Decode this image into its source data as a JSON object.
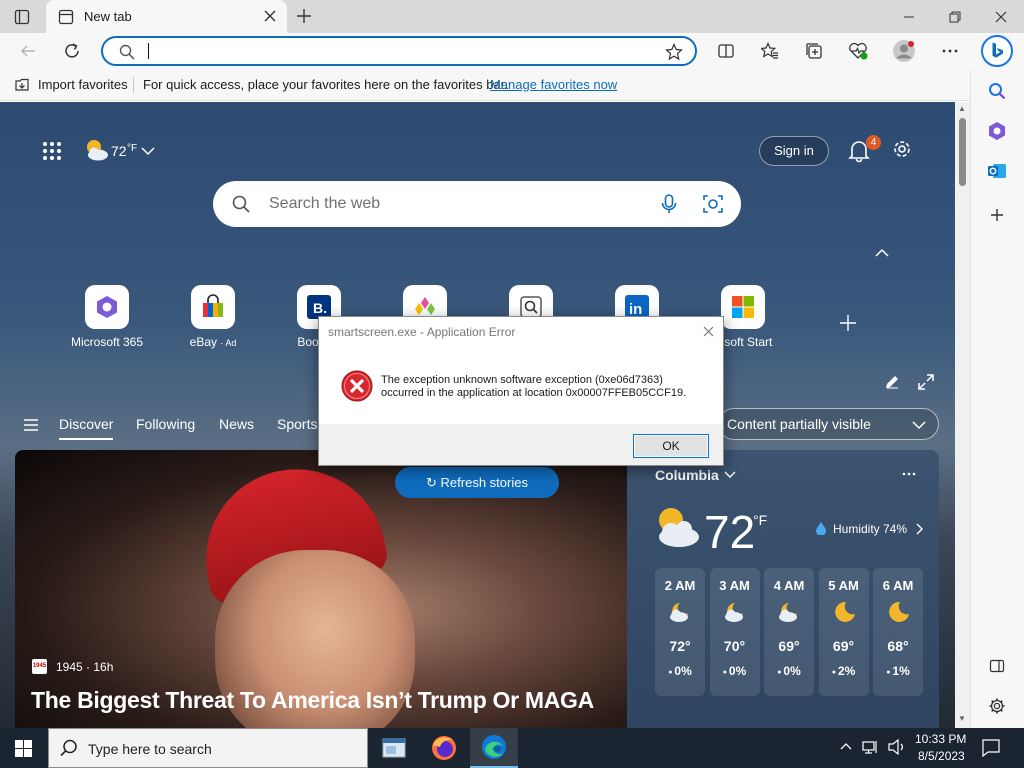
{
  "browser": {
    "tab_title": "New tab",
    "address_value": "",
    "favorites_bar": {
      "import_label": "Import favorites",
      "message": "For quick access, place your favorites here on the favorites bar.",
      "manage_link": "Manage favorites now"
    }
  },
  "page": {
    "weather_temp": "72",
    "weather_unit": "°F",
    "sign_in_label": "Sign in",
    "notification_count": "4",
    "search_placeholder": "Search the web",
    "quick_links": [
      {
        "label": "Microsoft 365"
      },
      {
        "label": "eBay",
        "badge": "· Ad"
      },
      {
        "label": "Booking"
      },
      {
        "label": ""
      },
      {
        "label": ""
      },
      {
        "label": ""
      },
      {
        "label": "rosoft Start"
      }
    ],
    "nav": {
      "items": [
        "Discover",
        "Following",
        "News",
        "Sports"
      ],
      "content_filter": "Content partially visible"
    },
    "hero": {
      "refresh_label": "Refresh stories",
      "source": "1945 · 16h",
      "source_logo": "1945",
      "headline": "The Biggest Threat To America Isn’t Trump Or MAGA"
    },
    "weather_card": {
      "location": "Columbia",
      "temp": "72",
      "unit": "°F",
      "humidity": "Humidity 74%",
      "hours": [
        {
          "time": "2 AM",
          "temp": "72°",
          "precip": "0%",
          "icon": "partly-cloudy-night"
        },
        {
          "time": "3 AM",
          "temp": "70°",
          "precip": "0%",
          "icon": "partly-cloudy-night"
        },
        {
          "time": "4 AM",
          "temp": "69°",
          "precip": "0%",
          "icon": "partly-cloudy-night"
        },
        {
          "time": "5 AM",
          "temp": "69°",
          "precip": "2%",
          "icon": "clear-night"
        },
        {
          "time": "6 AM",
          "temp": "68°",
          "precip": "1%",
          "icon": "clear-night"
        }
      ]
    }
  },
  "dialog": {
    "title": "smartscreen.exe - Application Error",
    "message_line1": "The exception unknown software exception (0xe06d7363)",
    "message_line2": "occurred in the application at location 0x00007FFEB05CCF19.",
    "ok_label": "OK"
  },
  "taskbar": {
    "search_placeholder": "Type here to search",
    "time": "10:33 PM",
    "date": "8/5/2023"
  },
  "colors": {
    "accent": "#0f6cbd",
    "error_red": "#d9272e",
    "taskbar_bg": "#1b2431"
  }
}
